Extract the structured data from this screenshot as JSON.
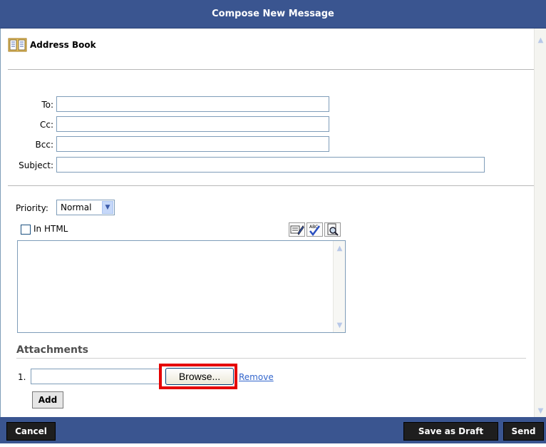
{
  "header": {
    "title": "Compose New Message"
  },
  "toolbar": {
    "address_book_label": "Address Book"
  },
  "fields": {
    "to_label": "To:",
    "to_value": "",
    "cc_label": "Cc:",
    "cc_value": "",
    "bcc_label": "Bcc:",
    "bcc_value": "",
    "subject_label": "Subject:",
    "subject_value": ""
  },
  "options": {
    "priority_label": "Priority:",
    "priority_value": "Normal",
    "in_html_label": "In HTML",
    "in_html_checked": false
  },
  "editor": {
    "tools": [
      "edit-icon",
      "spellcheck-icon",
      "preview-icon"
    ],
    "body": ""
  },
  "attachments": {
    "heading": "Attachments",
    "items": [
      {
        "number": "1.",
        "file_value": "",
        "browse_label": "Browse...",
        "remove_label": "Remove"
      }
    ],
    "add_label": "Add"
  },
  "footer": {
    "cancel_label": "Cancel",
    "save_draft_label": "Save as Draft",
    "send_label": "Send"
  },
  "colors": {
    "header_bg": "#3a5590",
    "button_bg": "#1e1e1e",
    "link": "#3366cc",
    "highlight": "#e50000"
  }
}
